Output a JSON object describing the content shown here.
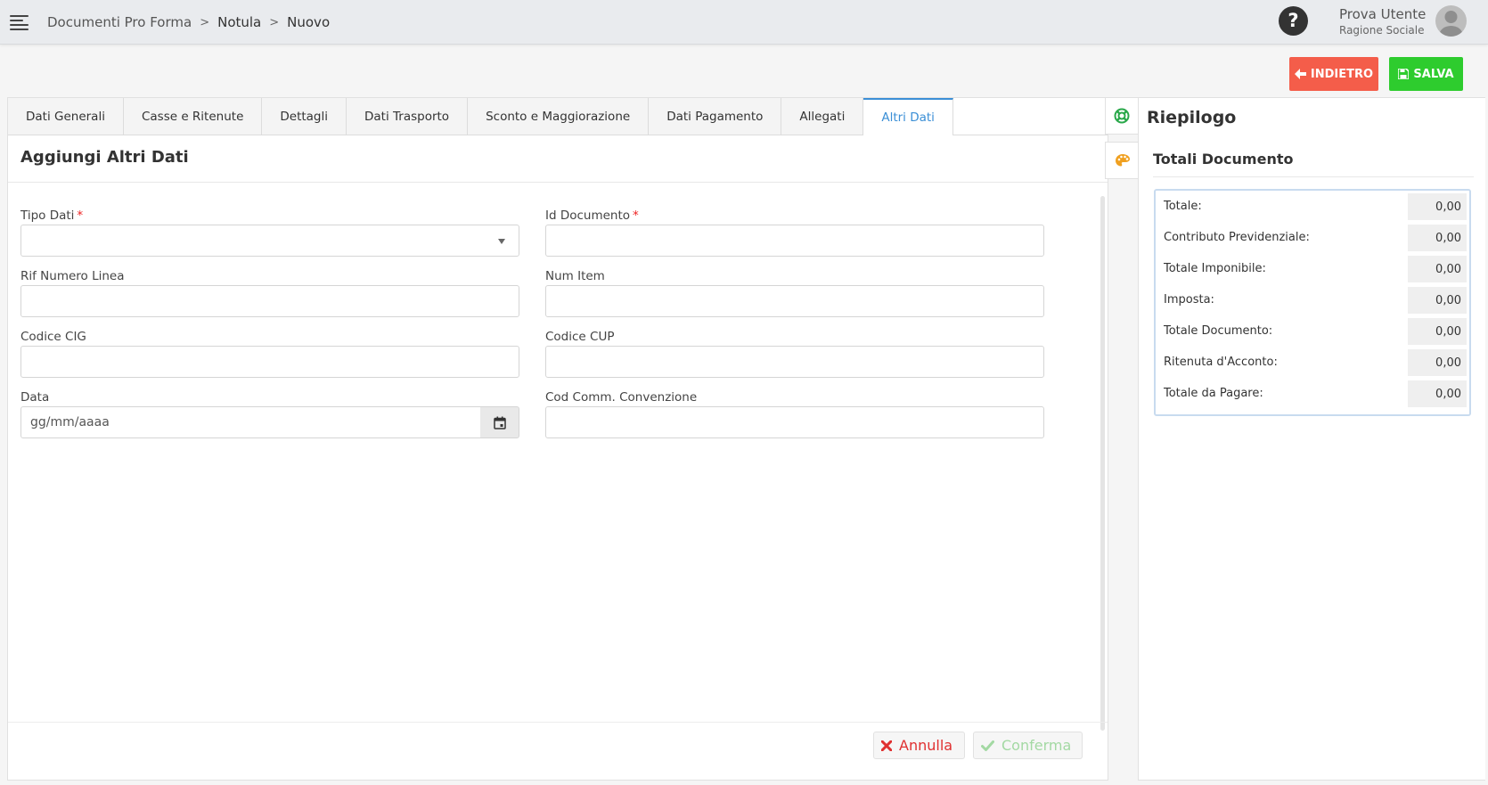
{
  "breadcrumb": [
    "Documenti Pro Forma",
    "Notula",
    "Nuovo"
  ],
  "user": {
    "name": "Prova Utente",
    "company": "Ragione Sociale"
  },
  "actions": {
    "back_label": "INDIETRO",
    "save_label": "SALVA"
  },
  "tabs": [
    {
      "label": "Dati Generali",
      "active": false
    },
    {
      "label": "Casse e Ritenute",
      "active": false
    },
    {
      "label": "Dettagli",
      "active": false
    },
    {
      "label": "Dati Trasporto",
      "active": false
    },
    {
      "label": "Sconto e Maggiorazione",
      "active": false
    },
    {
      "label": "Dati Pagamento",
      "active": false
    },
    {
      "label": "Allegati",
      "active": false
    },
    {
      "label": "Altri Dati",
      "active": true
    }
  ],
  "form": {
    "title": "Aggiungi Altri Dati",
    "fields": {
      "tipo_dati": {
        "label": "Tipo Dati",
        "value": ""
      },
      "id_documento": {
        "label": "Id Documento",
        "value": ""
      },
      "rif_numero_linea": {
        "label": "Rif Numero Linea",
        "value": ""
      },
      "num_item": {
        "label": "Num Item",
        "value": ""
      },
      "codice_cig": {
        "label": "Codice CIG",
        "value": ""
      },
      "codice_cup": {
        "label": "Codice CUP",
        "value": ""
      },
      "data": {
        "label": "Data",
        "value": "",
        "placeholder": "gg/mm/aaaa"
      },
      "cod_comm_convenzione": {
        "label": "Cod Comm. Convenzione",
        "value": ""
      }
    },
    "required_marker": "*",
    "cancel_label": "Annulla",
    "confirm_label": "Conferma"
  },
  "summary": {
    "title": "Riepilogo",
    "totals_title": "Totali Documento",
    "rows": [
      {
        "label": "Totale:",
        "value": "0,00"
      },
      {
        "label": "Contributo Previdenziale:",
        "value": "0,00"
      },
      {
        "label": "Totale Imponibile:",
        "value": "0,00"
      },
      {
        "label": "Imposta:",
        "value": "0,00"
      },
      {
        "label": "Totale Documento:",
        "value": "0,00"
      },
      {
        "label": "Ritenuta d'Acconto:",
        "value": "0,00"
      },
      {
        "label": "Totale da Pagare:",
        "value": "0,00"
      }
    ]
  },
  "colors": {
    "back_button": "#f45d4a",
    "save_button": "#2ecc2e",
    "active_tab": "#3b8fd6",
    "required": "#ee2222"
  }
}
